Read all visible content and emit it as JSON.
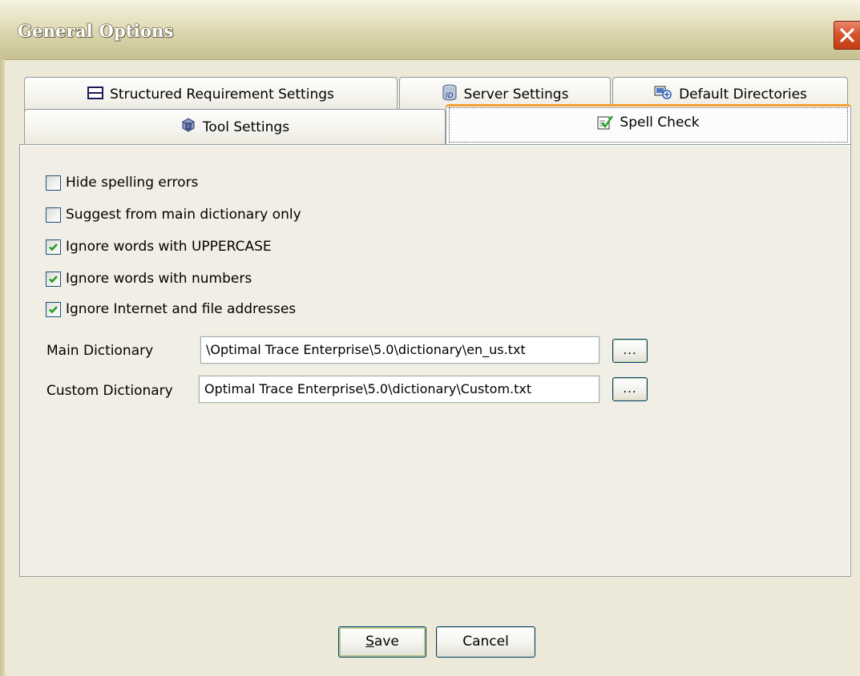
{
  "window": {
    "title": "General Options",
    "close_icon": "close-icon"
  },
  "tabs": {
    "row1": [
      {
        "label": "Structured Requirement Settings",
        "icon": "structured-requirement-icon"
      },
      {
        "label": "Server Settings",
        "icon": "server-icon"
      },
      {
        "label": "Default Directories",
        "icon": "directories-icon"
      }
    ],
    "row2": [
      {
        "label": "Tool Settings",
        "icon": "tool-settings-icon"
      },
      {
        "label": "Spell Check",
        "icon": "spell-check-icon",
        "active": true
      }
    ]
  },
  "spell_check": {
    "options": [
      {
        "label": "Hide spelling errors",
        "checked": false
      },
      {
        "label": "Suggest from main dictionary only",
        "checked": false
      },
      {
        "label": "Ignore words with UPPERCASE",
        "checked": true
      },
      {
        "label": "Ignore words with numbers",
        "checked": true
      },
      {
        "label": "Ignore Internet and file addresses",
        "checked": true
      }
    ],
    "main_dictionary": {
      "label": "Main Dictionary",
      "value": "\\Optimal Trace Enterprise\\5.0\\dictionary\\en_us.txt",
      "browse_label": "..."
    },
    "custom_dictionary": {
      "label": "Custom Dictionary",
      "value": "Optimal Trace Enterprise\\5.0\\dictionary\\Custom.txt",
      "browse_label": "..."
    }
  },
  "footer": {
    "save_label": "Save",
    "save_mnemonic": "S",
    "save_rest": "ave",
    "cancel_label": "Cancel"
  },
  "colors": {
    "window_bg": "#ece9d8",
    "active_tab_accent": "#f0a030",
    "checkbox_border": "#1c5180",
    "checkmark": "#21a121",
    "close_button": "#d8552f"
  }
}
